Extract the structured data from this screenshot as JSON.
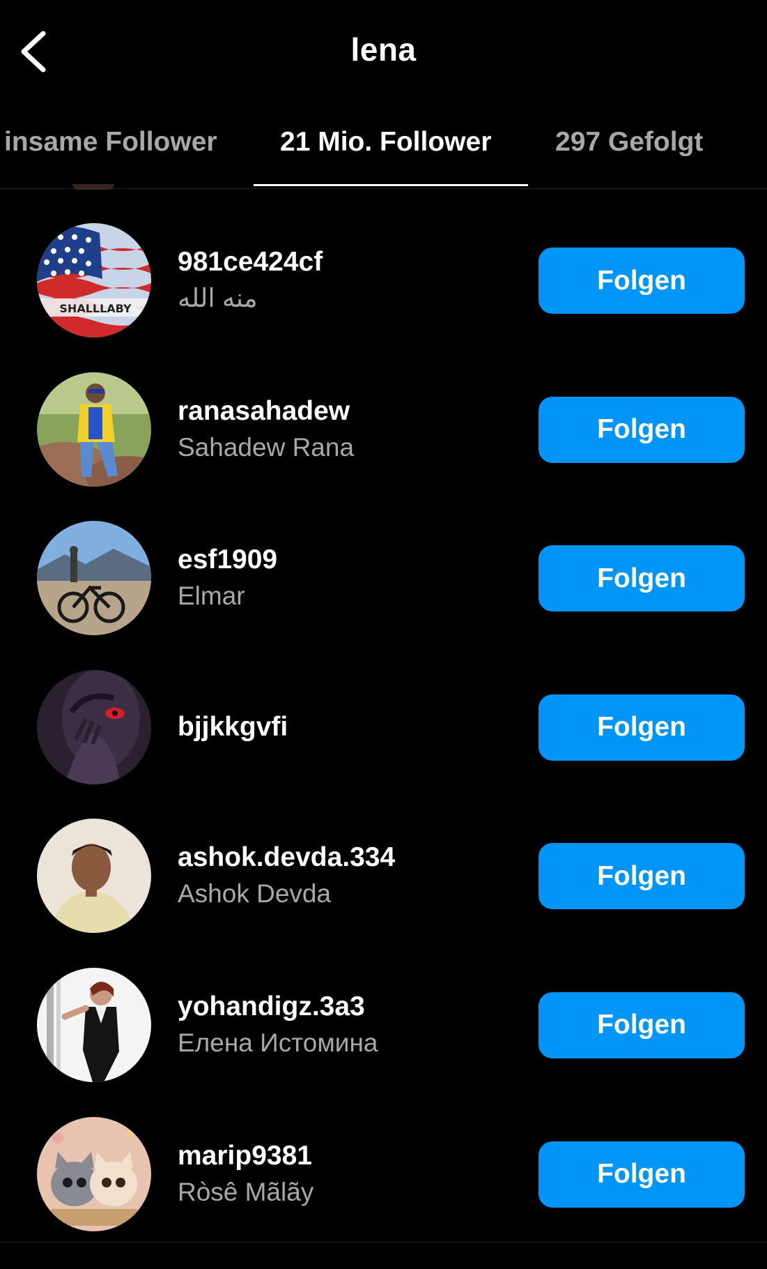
{
  "header": {
    "title": "lena"
  },
  "tabs": [
    {
      "label": "insame Follower",
      "active": false
    },
    {
      "label": "21 Mio. Follower",
      "active": true
    },
    {
      "label": "297 Gefolgt",
      "active": false
    }
  ],
  "follow_label": "Folgen",
  "followers": [
    {
      "username": "981ce424cf",
      "fullname": "منه الله",
      "avatar": "usa-flag-avatar"
    },
    {
      "username": "ranasahadew",
      "fullname": "Sahadew Rana",
      "avatar": "man-yellow-jacket-avatar"
    },
    {
      "username": "esf1909",
      "fullname": "Elmar",
      "avatar": "mountain-bike-avatar"
    },
    {
      "username": "bjjkkgvfi",
      "fullname": "",
      "avatar": "anime-red-eye-avatar"
    },
    {
      "username": "ashok.devda.334",
      "fullname": "Ashok Devda",
      "avatar": "selfie-man-avatar"
    },
    {
      "username": "yohandigz.3a3",
      "fullname": "Елена Истомина",
      "avatar": "woman-black-dress-avatar"
    },
    {
      "username": "marip9381",
      "fullname": "Ròsê Mãlãy",
      "avatar": "cartoon-kittens-avatar"
    }
  ],
  "avatar_text": {
    "flag_caption": "SHALLLABY"
  }
}
